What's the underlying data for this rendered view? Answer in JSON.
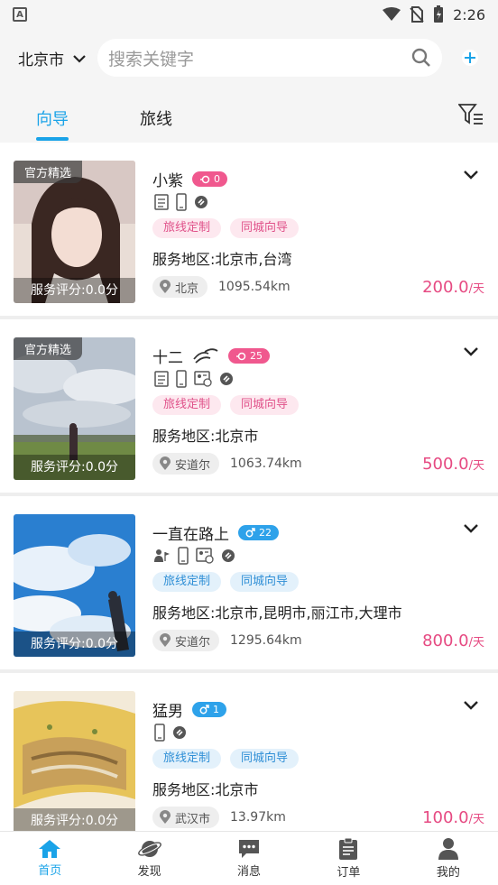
{
  "status_bar": {
    "time": "2:26",
    "app_glyph": "A"
  },
  "header": {
    "city": "北京市",
    "search_placeholder": "搜索关键字",
    "tabs": [
      {
        "label": "向导",
        "active": true
      },
      {
        "label": "旅线",
        "active": false
      }
    ]
  },
  "cards": [
    {
      "name": "小紫",
      "gender": "female",
      "count": "0",
      "official_badge": "官方精选",
      "score": "服务评分:0.0分",
      "tags": [
        "旅线定制",
        "同城向导"
      ],
      "area": "服务地区:北京市,台湾",
      "location": "北京",
      "distance": "1095.54km",
      "price": "200.0",
      "price_unit": "/天"
    },
    {
      "name": "十二",
      "gender": "female",
      "count": "25",
      "official_badge": "官方精选",
      "score": "服务评分:0.0分",
      "tags": [
        "旅线定制",
        "同城向导"
      ],
      "area": "服务地区:北京市",
      "location": "安道尔",
      "distance": "1063.74km",
      "price": "500.0",
      "price_unit": "/天"
    },
    {
      "name": "一直在路上",
      "gender": "male",
      "count": "22",
      "official_badge": "",
      "score": "服务评分:0.0分",
      "tags": [
        "旅线定制",
        "同城向导"
      ],
      "area": "服务地区:北京市,昆明市,丽江市,大理市",
      "location": "安道尔",
      "distance": "1295.64km",
      "price": "800.0",
      "price_unit": "/天"
    },
    {
      "name": "猛男",
      "gender": "male",
      "count": "1",
      "official_badge": "",
      "score": "服务评分:0.0分",
      "tags": [
        "旅线定制",
        "同城向导"
      ],
      "area": "服务地区:北京市",
      "location": "武汉市",
      "distance": "13.97km",
      "price": "100.0",
      "price_unit": "/天"
    }
  ],
  "bottom_nav": [
    {
      "label": "首页",
      "icon": "home-icon",
      "active": true
    },
    {
      "label": "发现",
      "icon": "planet-icon",
      "active": false
    },
    {
      "label": "消息",
      "icon": "chat-icon",
      "active": false
    },
    {
      "label": "订单",
      "icon": "clipboard-icon",
      "active": false
    },
    {
      "label": "我的",
      "icon": "person-icon",
      "active": false
    }
  ],
  "colors": {
    "accent": "#1aa3e8",
    "price": "#e64a82",
    "female": "#f0588e",
    "male": "#2ea2ea"
  }
}
